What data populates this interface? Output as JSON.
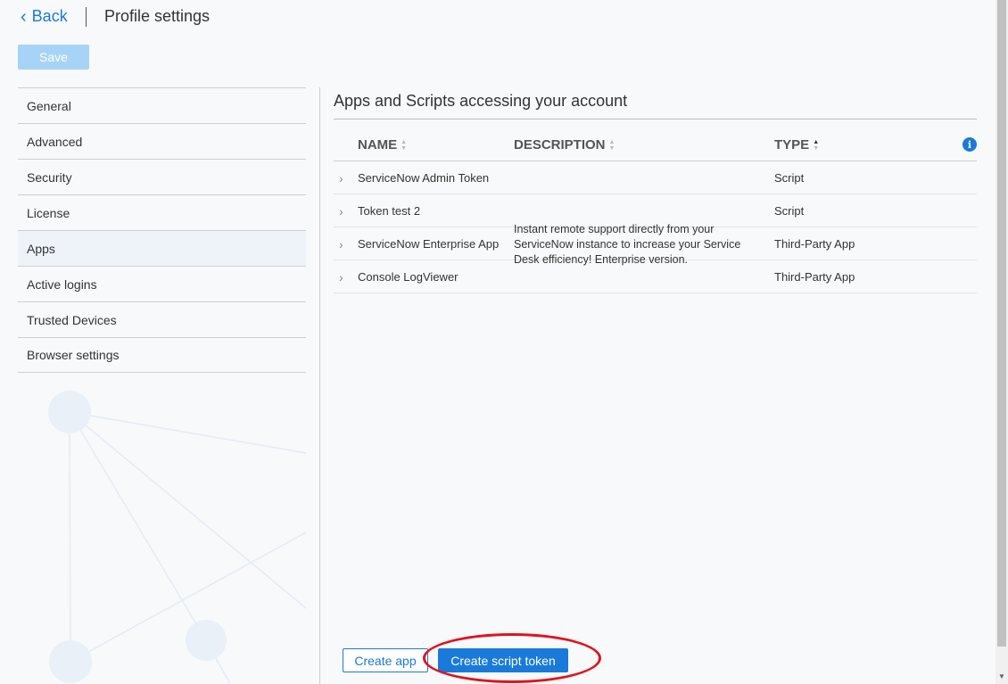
{
  "header": {
    "back_label": "Back",
    "title": "Profile settings",
    "save_label": "Save"
  },
  "sidebar": {
    "items": [
      {
        "label": "General"
      },
      {
        "label": "Advanced"
      },
      {
        "label": "Security"
      },
      {
        "label": "License"
      },
      {
        "label": "Apps",
        "active": true
      },
      {
        "label": "Active logins"
      },
      {
        "label": "Trusted Devices"
      },
      {
        "label": "Browser settings"
      }
    ]
  },
  "main": {
    "title": "Apps and Scripts accessing your account",
    "columns": {
      "name": "NAME",
      "description": "DESCRIPTION",
      "type": "TYPE"
    },
    "sorted_column": "type",
    "rows": [
      {
        "name": "ServiceNow Admin Token",
        "description": "",
        "type": "Script"
      },
      {
        "name": "Token test 2",
        "description": "",
        "type": "Script"
      },
      {
        "name": "ServiceNow Enterprise App",
        "description": "Instant remote support directly from your ServiceNow instance to increase your Service Desk efficiency! Enterprise version.",
        "type": "Third-Party App"
      },
      {
        "name": "Console LogViewer",
        "description": "",
        "type": "Third-Party App"
      }
    ],
    "create_app_label": "Create app",
    "create_script_token_label": "Create script token"
  },
  "colors": {
    "accent": "#1a7ad9",
    "save_disabled": "#a7d3f7",
    "highlight": "#e0141e",
    "active_item_bg": "#eef3fa"
  },
  "icons": {
    "back": "chevron-left-icon",
    "row_expand": "chevron-right-icon",
    "sort": "sort-arrows-icon",
    "info": "info-icon"
  }
}
